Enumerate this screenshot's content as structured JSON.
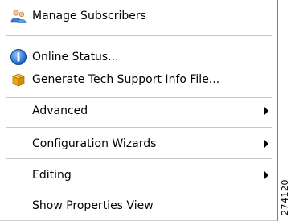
{
  "menu": {
    "items": [
      {
        "label": "Manage Subscribers",
        "icon": "users-icon"
      },
      {
        "label": "Online Status...",
        "icon": "info-icon"
      },
      {
        "label": "Generate Tech Support Info File...",
        "icon": "package-icon"
      },
      {
        "label": "Advanced",
        "submenu": true
      },
      {
        "label": "Configuration Wizards",
        "submenu": true
      },
      {
        "label": "Editing",
        "submenu": true
      },
      {
        "label": "Show Properties View"
      }
    ]
  },
  "figure_id": "274120"
}
